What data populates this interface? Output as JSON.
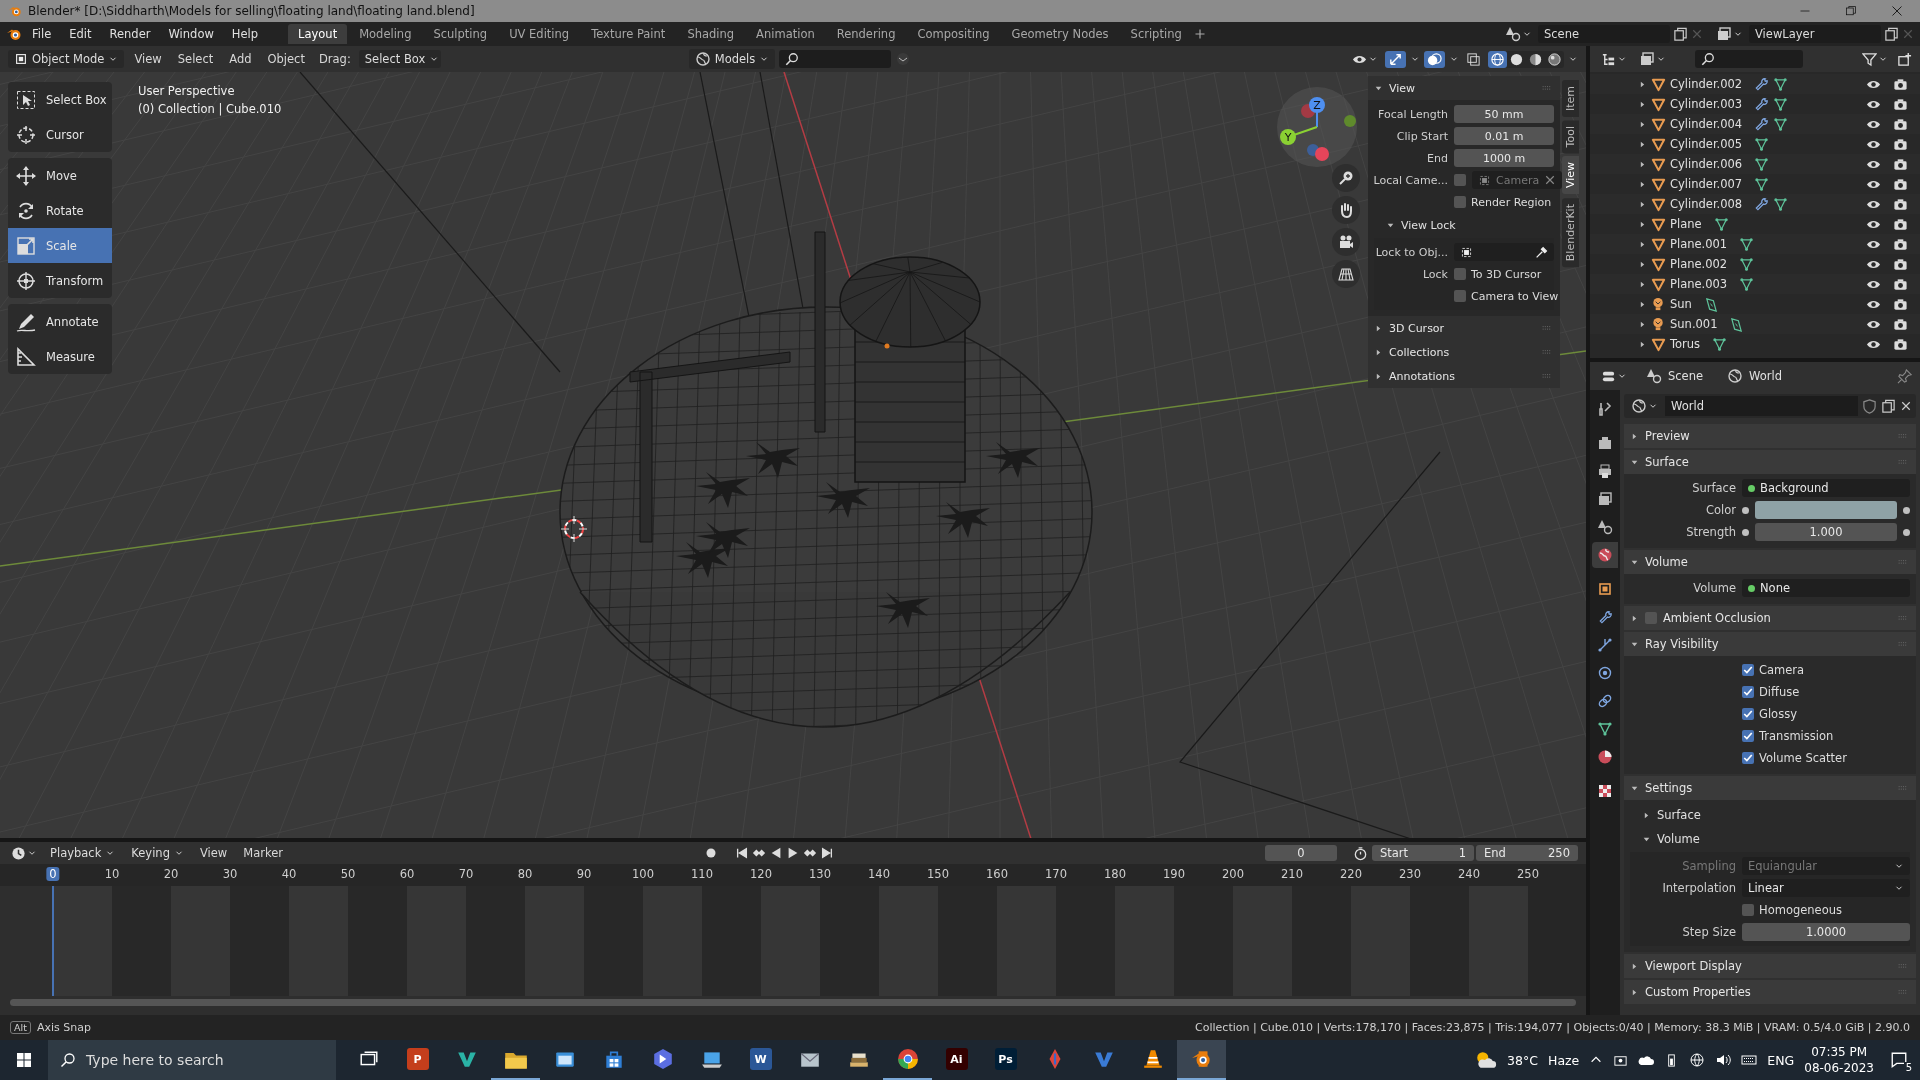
{
  "window": {
    "title": "Blender* [D:\\Siddharth\\Models for selling\\floating land\\floating land.blend]"
  },
  "menu": [
    "File",
    "Edit",
    "Render",
    "Window",
    "Help"
  ],
  "workspaces": [
    {
      "label": "Layout",
      "selected": true
    },
    {
      "label": "Modeling",
      "selected": false
    },
    {
      "label": "Sculpting",
      "selected": false
    },
    {
      "label": "UV Editing",
      "selected": false
    },
    {
      "label": "Texture Paint",
      "selected": false
    },
    {
      "label": "Shading",
      "selected": false
    },
    {
      "label": "Animation",
      "selected": false
    },
    {
      "label": "Rendering",
      "selected": false
    },
    {
      "label": "Compositing",
      "selected": false
    },
    {
      "label": "Geometry Nodes",
      "selected": false
    },
    {
      "label": "Scripting",
      "selected": false
    }
  ],
  "scene": "Scene",
  "view_layer": "ViewLayer",
  "viewport": {
    "mode": "Object Mode",
    "menus": [
      "View",
      "Select",
      "Add",
      "Object"
    ],
    "drag_label": "Drag:",
    "drag_value": "Select Box",
    "library": "Models",
    "shading": [
      {
        "kind": "wireframe",
        "selected": true
      },
      {
        "kind": "solid",
        "selected": false
      },
      {
        "kind": "material",
        "selected": false
      },
      {
        "kind": "rendered",
        "selected": false
      }
    ],
    "overlay_text": [
      "User Perspective",
      "(0) Collection | Cube.010"
    ],
    "tools": [
      [
        {
          "label": "Select Box",
          "kind": "select",
          "selected": false
        },
        {
          "label": "Cursor",
          "kind": "cursor",
          "selected": false
        }
      ],
      [
        {
          "label": "Move",
          "kind": "move",
          "selected": false
        },
        {
          "label": "Rotate",
          "kind": "rotate",
          "selected": false
        },
        {
          "label": "Scale",
          "kind": "scale",
          "selected": true
        },
        {
          "label": "Transform",
          "kind": "transform",
          "selected": false
        }
      ],
      [
        {
          "label": "Annotate",
          "kind": "annotate",
          "selected": false
        },
        {
          "label": "Measure",
          "kind": "measure",
          "selected": false
        }
      ]
    ],
    "gizmo": [
      "Z",
      "Y"
    ],
    "sidebar": {
      "tabs": [
        {
          "label": "Item",
          "selected": false
        },
        {
          "label": "Tool",
          "selected": false
        },
        {
          "label": "View",
          "selected": true
        },
        {
          "label": "BlenderKit",
          "selected": false
        }
      ],
      "panels": [
        {
          "title": "View",
          "expanded": true,
          "rows": [
            {
              "kind": "number",
              "label": "Focal Length",
              "value": "50 mm"
            },
            {
              "kind": "number",
              "label": "Clip Start",
              "value": "0.01 m"
            },
            {
              "kind": "number",
              "label": "End",
              "value": "1000 m"
            },
            {
              "kind": "local_camera",
              "label": "Local Came...",
              "checked": false,
              "placeholder": "Camera"
            },
            {
              "kind": "check",
              "text": "Render Region",
              "checked": false
            },
            {
              "kind": "subpanel",
              "title": "View Lock",
              "expanded": true,
              "rows": [
                {
                  "kind": "object_picker",
                  "label": "Lock to Obj..."
                },
                {
                  "kind": "check",
                  "label": "Lock",
                  "text": "To 3D Cursor",
                  "checked": false
                },
                {
                  "kind": "check",
                  "text": "Camera to View",
                  "checked": false
                }
              ]
            }
          ]
        },
        {
          "title": "3D Cursor",
          "expanded": false
        },
        {
          "title": "Collections",
          "expanded": false
        },
        {
          "title": "Annotations",
          "expanded": false
        }
      ]
    }
  },
  "outliner": {
    "rows": [
      {
        "name": "Cylinder.002",
        "kind": "mesh",
        "modifier": true,
        "expanded": false
      },
      {
        "name": "Cylinder.003",
        "kind": "mesh",
        "modifier": true,
        "expanded": false
      },
      {
        "name": "Cylinder.004",
        "kind": "mesh",
        "modifier": true,
        "expanded": false
      },
      {
        "name": "Cylinder.005",
        "kind": "mesh",
        "modifier": false,
        "expanded": false
      },
      {
        "name": "Cylinder.006",
        "kind": "mesh",
        "modifier": false,
        "expanded": false
      },
      {
        "name": "Cylinder.007",
        "kind": "mesh",
        "modifier": false,
        "expanded": false
      },
      {
        "name": "Cylinder.008",
        "kind": "mesh",
        "modifier": true,
        "expanded": false
      },
      {
        "name": "Plane",
        "kind": "mesh",
        "modifier": false,
        "expanded": false
      },
      {
        "name": "Plane.001",
        "kind": "mesh",
        "modifier": false,
        "expanded": false
      },
      {
        "name": "Plane.002",
        "kind": "mesh",
        "modifier": false,
        "expanded": false
      },
      {
        "name": "Plane.003",
        "kind": "mesh",
        "modifier": false,
        "expanded": false
      },
      {
        "name": "Sun",
        "kind": "light",
        "modifier": false,
        "expanded": false
      },
      {
        "name": "Sun.001",
        "kind": "light",
        "modifier": false,
        "expanded": false
      },
      {
        "name": "Torus",
        "kind": "mesh",
        "modifier": false,
        "expanded": false
      }
    ]
  },
  "properties": {
    "header_tabs": [
      {
        "label": "Scene",
        "kind": "scene"
      },
      {
        "label": "World",
        "kind": "world"
      }
    ],
    "datablock": "World",
    "tabs": [
      {
        "kind": "tool",
        "selected": false
      },
      {
        "kind": "render",
        "selected": false
      },
      {
        "kind": "output",
        "selected": false
      },
      {
        "kind": "view_layer",
        "selected": false
      },
      {
        "kind": "scene",
        "selected": false
      },
      {
        "kind": "world",
        "selected": true
      },
      {
        "kind": "object",
        "selected": false
      },
      {
        "kind": "modifiers",
        "selected": false
      },
      {
        "kind": "particles",
        "selected": false
      },
      {
        "kind": "physics",
        "selected": false
      },
      {
        "kind": "constraints",
        "selected": false
      },
      {
        "kind": "data",
        "selected": false
      },
      {
        "kind": "material",
        "selected": false
      },
      {
        "kind": "texture",
        "selected": false
      }
    ],
    "panels": [
      {
        "title": "Preview",
        "expanded": false
      },
      {
        "title": "Surface",
        "expanded": true,
        "rows": [
          {
            "kind": "link",
            "label": "Surface",
            "value": "Background"
          },
          {
            "kind": "color",
            "label": "Color",
            "color": "#8fa2a6"
          },
          {
            "kind": "socket_number",
            "label": "Strength",
            "value": "1.000"
          }
        ]
      },
      {
        "title": "Volume",
        "expanded": true,
        "rows": [
          {
            "kind": "link",
            "label": "Volume",
            "value": "None"
          }
        ]
      },
      {
        "title": "Ambient Occlusion",
        "expanded": false,
        "checked": false
      },
      {
        "title": "Ray Visibility",
        "expanded": true,
        "rows": [
          {
            "kind": "check",
            "text": "Camera",
            "checked": true
          },
          {
            "kind": "check",
            "text": "Diffuse",
            "checked": true
          },
          {
            "kind": "check",
            "text": "Glossy",
            "checked": true
          },
          {
            "kind": "check",
            "text": "Transmission",
            "checked": true
          },
          {
            "kind": "check",
            "text": "Volume Scatter",
            "checked": true
          }
        ]
      },
      {
        "title": "Settings",
        "expanded": true,
        "rows": [
          {
            "kind": "subpanel",
            "title": "Surface",
            "expanded": false
          },
          {
            "kind": "subpanel",
            "title": "Volume",
            "expanded": true,
            "rows": [
              {
                "kind": "dropdown",
                "label": "Sampling",
                "value": "Equiangular",
                "disabled": true
              },
              {
                "kind": "dropdown",
                "label": "Interpolation",
                "value": "Linear",
                "disabled": false
              },
              {
                "kind": "check",
                "text": "Homogeneous",
                "checked": false
              },
              {
                "kind": "number",
                "label": "Step Size",
                "value": "1.0000"
              }
            ]
          }
        ]
      },
      {
        "title": "Viewport Display",
        "expanded": false
      },
      {
        "title": "Custom Properties",
        "expanded": false
      }
    ]
  },
  "timeline": {
    "menus": [
      {
        "label": "Playback",
        "kind": "dropdown"
      },
      {
        "label": "Keying",
        "kind": "dropdown"
      },
      {
        "label": "View",
        "kind": "menu"
      },
      {
        "label": "Marker",
        "kind": "menu"
      }
    ],
    "current_frame": "0",
    "start_label": "Start",
    "start": "1",
    "end_label": "End",
    "end": "250",
    "ruler": [
      {
        "label": "0",
        "selected": true
      },
      {
        "label": "10",
        "selected": false
      },
      {
        "label": "20",
        "selected": false
      },
      {
        "label": "30",
        "selected": false
      },
      {
        "label": "40",
        "selected": false
      },
      {
        "label": "50",
        "selected": false
      },
      {
        "label": "60",
        "selected": false
      },
      {
        "label": "70",
        "selected": false
      },
      {
        "label": "80",
        "selected": false
      },
      {
        "label": "90",
        "selected": false
      },
      {
        "label": "100",
        "selected": false
      },
      {
        "label": "110",
        "selected": false
      },
      {
        "label": "120",
        "selected": false
      },
      {
        "label": "130",
        "selected": false
      },
      {
        "label": "140",
        "selected": false
      },
      {
        "label": "150",
        "selected": false
      },
      {
        "label": "160",
        "selected": false
      },
      {
        "label": "170",
        "selected": false
      },
      {
        "label": "180",
        "selected": false
      },
      {
        "label": "190",
        "selected": false
      },
      {
        "label": "200",
        "selected": false
      },
      {
        "label": "210",
        "selected": false
      },
      {
        "label": "220",
        "selected": false
      },
      {
        "label": "230",
        "selected": false
      },
      {
        "label": "240",
        "selected": false
      },
      {
        "label": "250",
        "selected": false
      }
    ]
  },
  "status_bar": {
    "key": "Alt",
    "hint": "Axis Snap",
    "stats": "Collection | Cube.010 | Verts:178,170 | Faces:23,875 | Tris:194,077 | Objects:0/40 | Memory: 38.3 MiB | VRAM: 0.5/4.0 GiB | 2.90.0"
  },
  "taskbar": {
    "search_placeholder": "Type here to search",
    "apps": [
      {
        "kind": "task_view",
        "color": "#ffffff",
        "open": false,
        "selected": false
      },
      {
        "kind": "tile",
        "color": "#c43e1c",
        "label": "P",
        "open": false,
        "selected": false
      },
      {
        "kind": "chevron",
        "color": "#2ab3a6",
        "open": false,
        "selected": false
      },
      {
        "kind": "folder",
        "color": "#f2c94c",
        "open": true,
        "selected": false
      },
      {
        "kind": "window",
        "color": "#3a8fd8",
        "open": false,
        "selected": false
      },
      {
        "kind": "bag",
        "color": "#2f7fd6",
        "open": false,
        "selected": false
      },
      {
        "kind": "hexagon",
        "color": "#5b6ee1",
        "open": false,
        "selected": false
      },
      {
        "kind": "laptop",
        "color": "#4aa3e8",
        "open": false,
        "selected": false
      },
      {
        "kind": "tile",
        "color": "#2b5797",
        "label": "W",
        "open": false,
        "selected": false
      },
      {
        "kind": "envelope",
        "color": "#b8c4cc",
        "open": false,
        "selected": false
      },
      {
        "kind": "books",
        "color": "#d9b36c",
        "open": false,
        "selected": false
      },
      {
        "kind": "chrome",
        "color": "#db4437",
        "open": true,
        "selected": false
      },
      {
        "kind": "tile",
        "color": "#330000",
        "label": "Ai",
        "open": false,
        "selected": false
      },
      {
        "kind": "tile",
        "color": "#001e36",
        "label": "Ps",
        "open": false,
        "selected": false
      },
      {
        "kind": "pen",
        "color": "#e0453a",
        "open": false,
        "selected": false
      },
      {
        "kind": "chevron",
        "color": "#3a7bd5",
        "open": false,
        "selected": false
      },
      {
        "kind": "cone",
        "color": "#f08a00",
        "open": false,
        "selected": false
      },
      {
        "kind": "blender",
        "color": "#e87d0d",
        "open": true,
        "selected": true
      }
    ],
    "temperature": "38°C",
    "condition": "Haze",
    "language": "ENG",
    "time": "07:35 PM",
    "date": "08-06-2023",
    "notifications": "5"
  }
}
